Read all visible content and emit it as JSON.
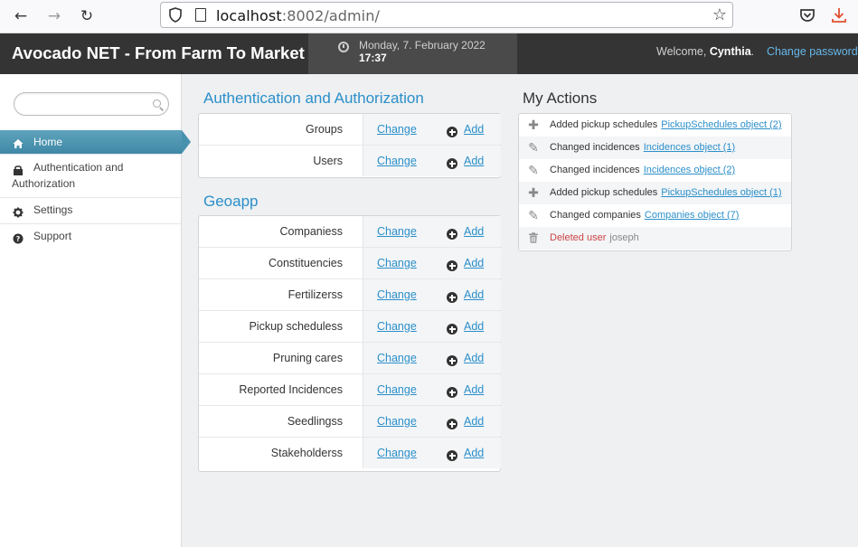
{
  "browser": {
    "url_host": "localhost",
    "url_rest": ":8002/admin/"
  },
  "header": {
    "brand": "Avocado NET - From Farm To Market",
    "date": "Monday, 7. February 2022",
    "time": "17:37",
    "welcome_prefix": "Welcome, ",
    "user": "Cynthia",
    "welcome_suffix": ".",
    "change_password": "Change password"
  },
  "sidebar": {
    "search_placeholder": "",
    "items": [
      {
        "label": "Home",
        "icon": "home-icon"
      },
      {
        "label": "Authentication and",
        "label2": "Authorization",
        "icon": "lock-icon"
      },
      {
        "label": "Settings",
        "icon": "gear-icon"
      },
      {
        "label": "Support",
        "icon": "question-icon"
      }
    ]
  },
  "modules": [
    {
      "title": "Authentication and Authorization",
      "rows": [
        {
          "name": "Groups",
          "change": "Change",
          "add": "Add"
        },
        {
          "name": "Users",
          "change": "Change",
          "add": "Add"
        }
      ]
    },
    {
      "title": "Geoapp",
      "rows": [
        {
          "name": "Companiess",
          "change": "Change",
          "add": "Add"
        },
        {
          "name": "Constituencies",
          "change": "Change",
          "add": "Add"
        },
        {
          "name": "Fertilizerss",
          "change": "Change",
          "add": "Add"
        },
        {
          "name": "Pickup scheduless",
          "change": "Change",
          "add": "Add"
        },
        {
          "name": "Pruning cares",
          "change": "Change",
          "add": "Add"
        },
        {
          "name": "Reported Incidences",
          "change": "Change",
          "add": "Add"
        },
        {
          "name": "Seedlingss",
          "change": "Change",
          "add": "Add"
        },
        {
          "name": "Stakeholderss",
          "change": "Change",
          "add": "Add"
        }
      ]
    }
  ],
  "my_actions": {
    "title": "My Actions",
    "items": [
      {
        "type": "add",
        "icon": "plus-icon",
        "text": "Added pickup schedules",
        "object": "PickupSchedules object (2)"
      },
      {
        "type": "change",
        "icon": "pencil-icon",
        "text": "Changed incidences",
        "object": "Incidences object (1)"
      },
      {
        "type": "change",
        "icon": "pencil-icon",
        "text": "Changed incidences",
        "object": "Incidences object (2)"
      },
      {
        "type": "add",
        "icon": "plus-icon",
        "text": "Added pickup schedules",
        "object": "PickupSchedules object (1)"
      },
      {
        "type": "change",
        "icon": "pencil-icon",
        "text": "Changed companies",
        "object": "Companies object (7)"
      },
      {
        "type": "delete",
        "icon": "trash-icon",
        "text": "Deleted user",
        "object": "joseph"
      }
    ]
  }
}
